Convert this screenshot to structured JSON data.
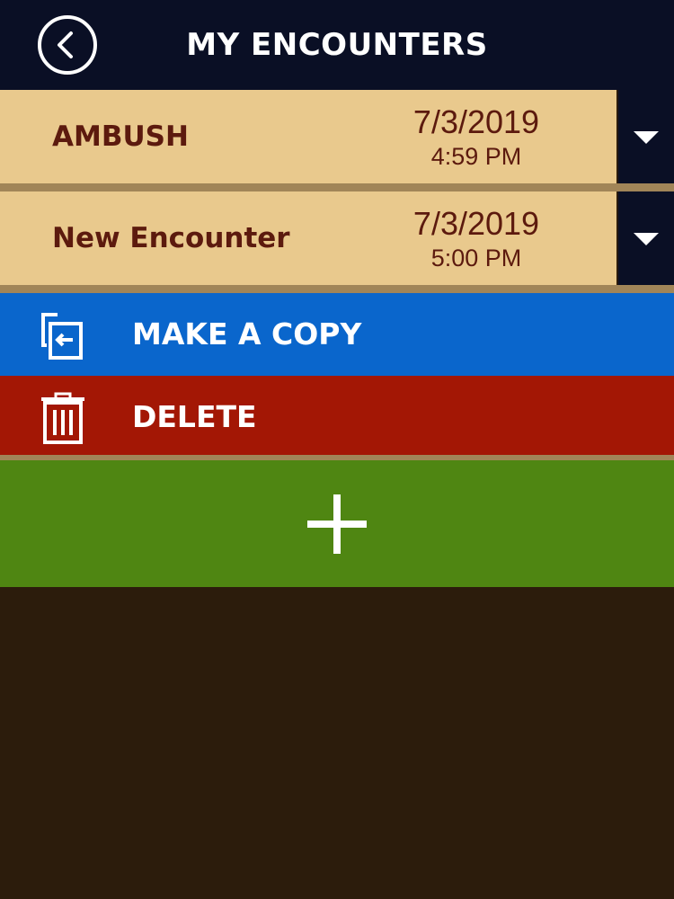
{
  "header": {
    "title": "MY ENCOUNTERS",
    "back_icon": "chevron-left-circle-icon"
  },
  "encounters": [
    {
      "name": "AMBUSH",
      "date": "7/3/2019",
      "time": "4:59 PM"
    },
    {
      "name": "New Encounter",
      "date": "7/3/2019",
      "time": "5:00 PM"
    }
  ],
  "actions": {
    "copy_label": "MAKE A COPY",
    "copy_icon": "copy-icon",
    "delete_label": "DELETE",
    "delete_icon": "trash-icon"
  },
  "add": {
    "icon": "plus-icon"
  },
  "colors": {
    "header_bg": "#0a0f25",
    "row_bg": "#e9c98d",
    "row_text": "#5c1a0e",
    "copy_bg": "#0a66cc",
    "delete_bg": "#a31705",
    "add_bg": "#4f8612",
    "page_bg": "#2c1c0c"
  }
}
